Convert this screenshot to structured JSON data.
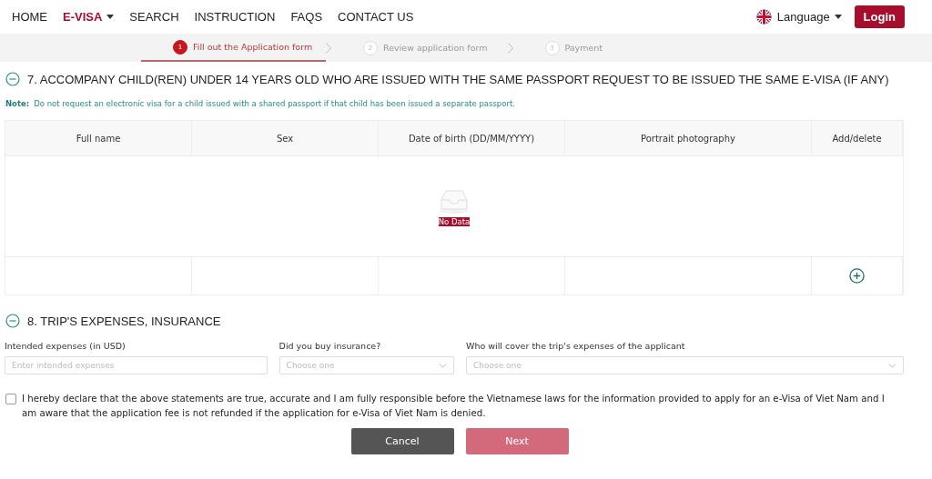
{
  "nav": {
    "items": [
      {
        "label": "HOME",
        "selected": false,
        "dropdown": false
      },
      {
        "label": "E-VISA",
        "selected": true,
        "dropdown": true
      },
      {
        "label": "SEARCH",
        "selected": false,
        "dropdown": false
      },
      {
        "label": "INSTRUCTION",
        "selected": false,
        "dropdown": false
      },
      {
        "label": "FAQS",
        "selected": false,
        "dropdown": false
      },
      {
        "label": "CONTACT US",
        "selected": false,
        "dropdown": false
      }
    ],
    "language": "Language",
    "login": "Login"
  },
  "steps": [
    {
      "number": "1",
      "label": "Fill out the Application form",
      "selected": true
    },
    {
      "number": "2",
      "label": "Review application form",
      "selected": false
    },
    {
      "number": "3",
      "label": "Payment",
      "selected": false
    }
  ],
  "section7": {
    "title": "7. ACCOMPANY CHILD(REN) UNDER 14 YEARS OLD WHO ARE ISSUED WITH THE SAME PASSPORT REQUEST TO BE ISSUED THE SAME E-VISA (IF ANY)",
    "expanded": true,
    "note_label": "Note:",
    "note": "Do not request an electronic visa for a child issued with a shared passport if that child has been issued a separate passport.",
    "table": {
      "columns": [
        "Full name",
        "Sex",
        "Date of birth (DD/MM/YYYY)",
        "Portrait photography",
        "Add/delete"
      ],
      "empty_text": "No Data"
    }
  },
  "section8": {
    "title": "8. TRIP'S EXPENSES, INSURANCE",
    "expanded": true,
    "fields": [
      {
        "kind": "input",
        "label": "Intended expenses (in USD)",
        "placeholder": "Enter intended expenses"
      },
      {
        "kind": "select",
        "label": "Did you buy insurance?",
        "placeholder": "Choose one"
      },
      {
        "kind": "select",
        "label": "Who will cover the trip's expenses of the applicant",
        "placeholder": "Choose one"
      }
    ]
  },
  "declaration": {
    "checked": false,
    "text": "I hereby declare that the above statements are true, accurate and I am fully responsible before the Vietnamese laws for the information provided to apply for an e-Visa of Viet Nam and I am aware that the application fee is not refunded if the application for e-Visa of Viet Nam is denied."
  },
  "buttons": [
    {
      "kind": "cancel",
      "label": "Cancel"
    },
    {
      "kind": "next",
      "label": "Next"
    }
  ]
}
